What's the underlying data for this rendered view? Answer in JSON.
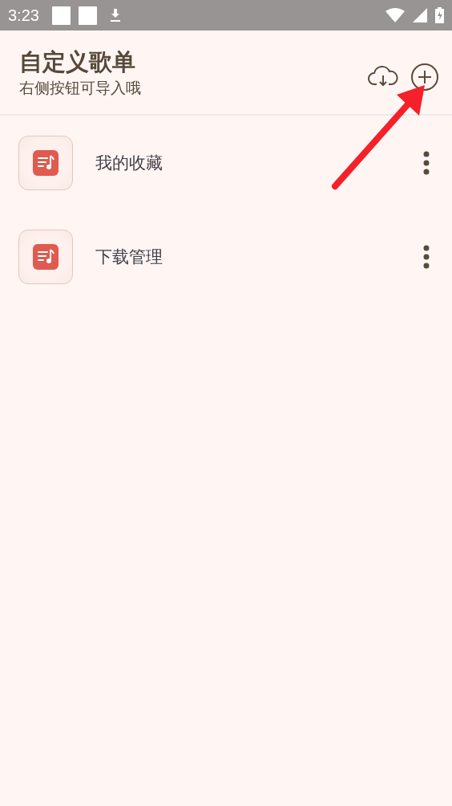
{
  "status_bar": {
    "time": "3:23"
  },
  "header": {
    "title": "自定义歌单",
    "subtitle": "右侧按钮可导入哦"
  },
  "playlists": [
    {
      "name": "我的收藏"
    },
    {
      "name": "下载管理"
    }
  ]
}
